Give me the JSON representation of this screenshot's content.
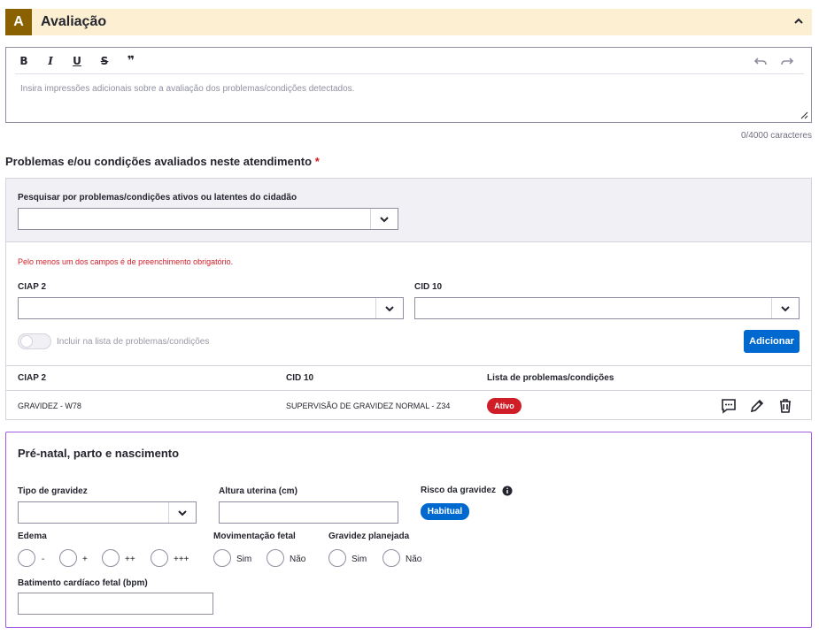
{
  "section": {
    "letter": "A",
    "title": "Avaliação"
  },
  "editor": {
    "toolbar": {
      "bold": "B",
      "italic": "I",
      "underline": "U",
      "strike": "S",
      "quote": "❞"
    },
    "placeholder": "Insira impressões adicionais sobre a avaliação dos problemas/condições detectados.",
    "char_count": "0/4000 caracteres"
  },
  "problems": {
    "title": "Problemas e/ou condições avaliados neste atendimento",
    "required_mark": "*",
    "search_label": "Pesquisar por problemas/condições ativos ou latentes do cidadão",
    "error": "Pelo menos um dos campos é de preenchimento obrigatório.",
    "ciap_label": "CIAP 2",
    "cid_label": "CID 10",
    "toggle_label": "Incluir na lista de problemas/condições",
    "add_button": "Adicionar",
    "table": {
      "headers": [
        "CIAP 2",
        "CID 10",
        "Lista de problemas/condições"
      ],
      "rows": [
        {
          "ciap": "GRAVIDEZ - W78",
          "cid": "SUPERVISÃO DE GRAVIDEZ NORMAL - Z34",
          "status": "Ativo"
        }
      ]
    }
  },
  "prenatal": {
    "title": "Pré-natal, parto e nascimento",
    "pregnancy_type_label": "Tipo de gravidez",
    "uterine_height_label": "Altura uterina (cm)",
    "risk_label": "Risco da gravidez",
    "risk_value": "Habitual",
    "edema_label": "Edema",
    "edema_options": [
      "-",
      "+",
      "++",
      "+++"
    ],
    "fetal_movement_label": "Movimentação fetal",
    "fetal_movement_options": [
      "Sim",
      "Não"
    ],
    "planned_label": "Gravidez planejada",
    "planned_options": [
      "Sim",
      "Não"
    ],
    "heartbeat_label": "Batimento cardíaco fetal (bpm)"
  },
  "colors": {
    "header_bg": "#fcefd2",
    "letter_bg": "#8a6100",
    "primary": "#0069d0",
    "danger": "#d01e29",
    "purple_border": "#a45de0"
  }
}
